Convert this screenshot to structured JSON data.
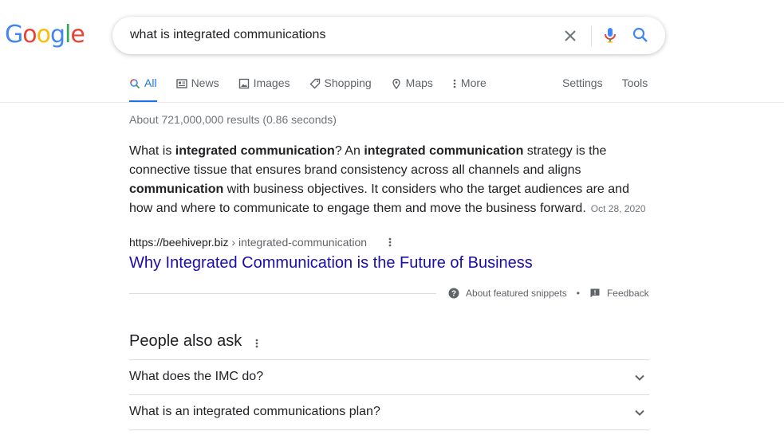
{
  "logo": {
    "letters": [
      "G",
      "o",
      "o",
      "g",
      "l",
      "e"
    ],
    "colors": [
      "#4285F4",
      "#EA4335",
      "#FBBC05",
      "#4285F4",
      "#34A853",
      "#EA4335"
    ]
  },
  "search": {
    "query": "what is integrated communications"
  },
  "tabs": [
    {
      "label": "All",
      "icon": "search-icon",
      "active": true
    },
    {
      "label": "News",
      "icon": "news-icon"
    },
    {
      "label": "Images",
      "icon": "image-icon"
    },
    {
      "label": "Shopping",
      "icon": "tag-icon"
    },
    {
      "label": "Maps",
      "icon": "pin-icon"
    },
    {
      "label": "More",
      "icon": "kebab-icon"
    }
  ],
  "tools": {
    "settings": "Settings",
    "tools": "Tools"
  },
  "stats": "About 721,000,000 results (0.86 seconds)",
  "snippet": {
    "p1": "What is ",
    "b1": "integrated communication",
    "p2": "? An ",
    "b2": "integrated communication",
    "p3": " strategy is the connective tissue that ensures brand consistency across all channels and aligns ",
    "b3": "communication",
    "p4": " with business objectives. It considers who the target audiences are and how and where to communicate to engage them and move the business forward.",
    "date": "Oct 28, 2020"
  },
  "result": {
    "domain": "https://beehivepr.biz",
    "path": " › integrated-communication",
    "title": "Why Integrated Communication is the Future of Business"
  },
  "about": {
    "featured": "About featured snippets",
    "dot": "•",
    "feedback": "Feedback"
  },
  "paa": {
    "title": "People also ask",
    "questions": [
      "What does the IMC do?",
      "What is an integrated communications plan?"
    ]
  },
  "colors": {
    "link": "#1a0dab",
    "accent": "#1a73e8",
    "muted": "#70757a"
  }
}
